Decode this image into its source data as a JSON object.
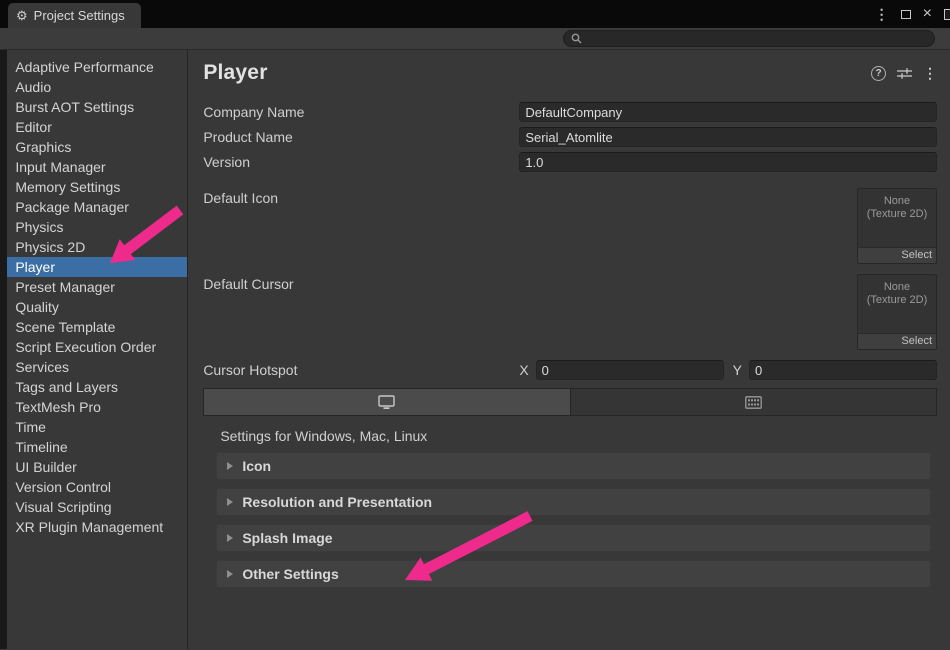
{
  "window": {
    "tab_title": "Project Settings"
  },
  "search": {
    "value": "",
    "placeholder": ""
  },
  "sidebar": {
    "items": [
      {
        "label": "Adaptive Performance"
      },
      {
        "label": "Audio"
      },
      {
        "label": "Burst AOT Settings"
      },
      {
        "label": "Editor"
      },
      {
        "label": "Graphics"
      },
      {
        "label": "Input Manager"
      },
      {
        "label": "Memory Settings"
      },
      {
        "label": "Package Manager"
      },
      {
        "label": "Physics"
      },
      {
        "label": "Physics 2D"
      },
      {
        "label": "Player",
        "selected": true
      },
      {
        "label": "Preset Manager"
      },
      {
        "label": "Quality"
      },
      {
        "label": "Scene Template"
      },
      {
        "label": "Script Execution Order"
      },
      {
        "label": "Services"
      },
      {
        "label": "Tags and Layers"
      },
      {
        "label": "TextMesh Pro"
      },
      {
        "label": "Time"
      },
      {
        "label": "Timeline"
      },
      {
        "label": "UI Builder"
      },
      {
        "label": "Version Control"
      },
      {
        "label": "Visual Scripting"
      },
      {
        "label": "XR Plugin Management"
      }
    ]
  },
  "player": {
    "title": "Player",
    "company_name": {
      "label": "Company Name",
      "value": "DefaultCompany"
    },
    "product_name": {
      "label": "Product Name",
      "value": "Serial_Atomlite"
    },
    "version": {
      "label": "Version",
      "value": "1.0"
    },
    "default_icon": {
      "label": "Default Icon",
      "none_text": "None",
      "type_text": "(Texture 2D)",
      "select_label": "Select"
    },
    "default_cursor": {
      "label": "Default Cursor",
      "none_text": "None",
      "type_text": "(Texture 2D)",
      "select_label": "Select"
    },
    "cursor_hotspot": {
      "label": "Cursor Hotspot",
      "x_label": "X",
      "x_value": "0",
      "y_label": "Y",
      "y_value": "0"
    },
    "settings_for": "Settings for Windows, Mac, Linux",
    "sections": [
      {
        "label": "Icon"
      },
      {
        "label": "Resolution and Presentation"
      },
      {
        "label": "Splash Image"
      },
      {
        "label": "Other Settings"
      }
    ]
  },
  "annotations": {
    "arrow_color": "#ee2b8c"
  }
}
